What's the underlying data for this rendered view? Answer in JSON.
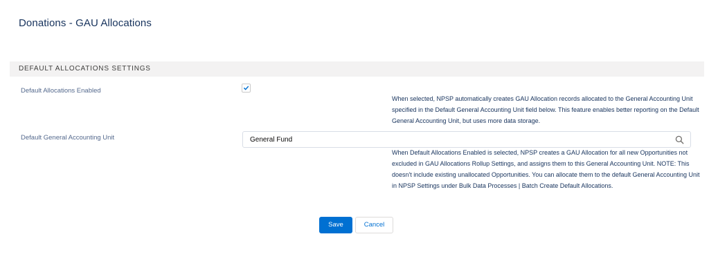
{
  "page": {
    "title": "Donations - GAU Allocations"
  },
  "section": {
    "header": "DEFAULT ALLOCATIONS SETTINGS"
  },
  "fields": {
    "default_allocations_enabled": {
      "label": "Default Allocations Enabled",
      "checked": true,
      "help": "When selected, NPSP automatically creates GAU Allocation records allocated to the General Accounting Unit specified in the Default General Accounting Unit field below. This feature enables better reporting on the Default General Accounting Unit, but uses more data storage."
    },
    "default_gau": {
      "label": "Default General Accounting Unit",
      "value": "General Fund",
      "icon": "search-icon",
      "help": "When Default Allocations Enabled is selected, NPSP creates a GAU Allocation for all new Opportunities not excluded in GAU Allocations Rollup Settings, and assigns them to this General Accounting Unit. NOTE: This doesn't include existing unallocated Opportunities. You can allocate them to the default General Accounting Unit in NPSP Settings under Bulk Data Processes | Batch Create Default Allocations."
    }
  },
  "actions": {
    "save_label": "Save",
    "cancel_label": "Cancel"
  },
  "colors": {
    "brand": "#0070d2",
    "title": "#16325c",
    "label": "#54698d",
    "section_bg": "#f3f2f2"
  }
}
